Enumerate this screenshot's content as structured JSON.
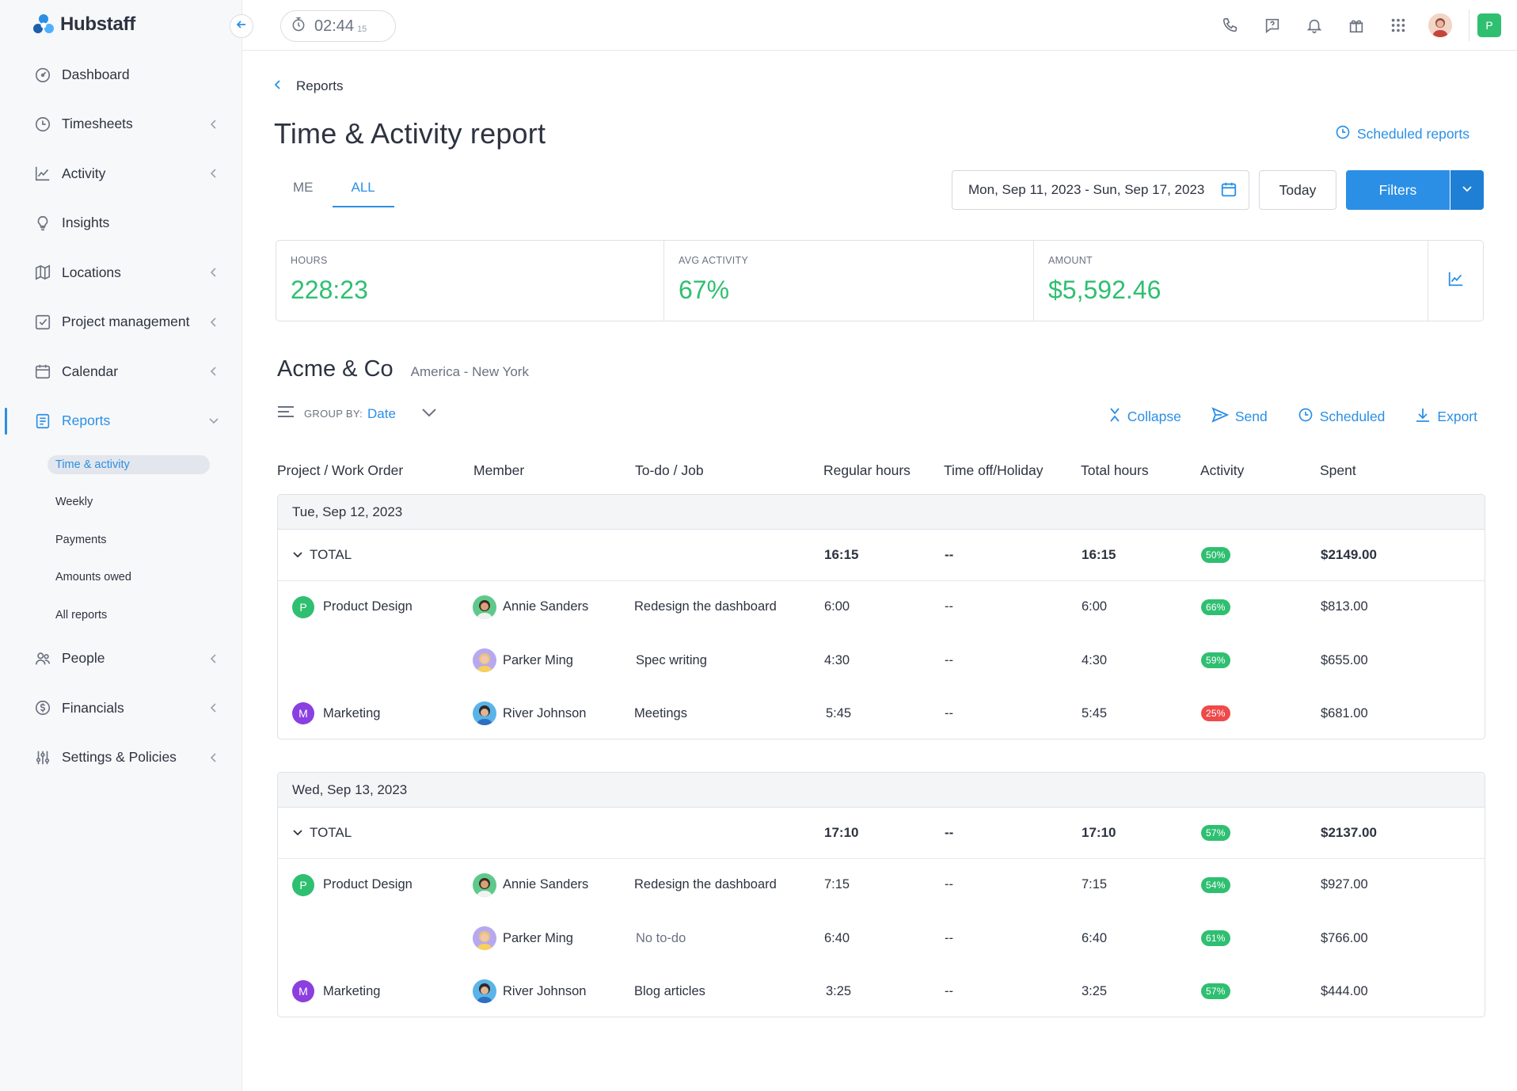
{
  "app": {
    "name": "Hubstaff"
  },
  "sidebar": {
    "items": [
      {
        "label": "Dashboard",
        "icon": "dashboard-icon",
        "chevron": false
      },
      {
        "label": "Timesheets",
        "icon": "clock-icon",
        "chevron": true
      },
      {
        "label": "Activity",
        "icon": "chart-line-icon",
        "chevron": true
      },
      {
        "label": "Insights",
        "icon": "lightbulb-icon",
        "chevron": false
      },
      {
        "label": "Locations",
        "icon": "map-icon",
        "chevron": true
      },
      {
        "label": "Project management",
        "icon": "checkbox-icon",
        "chevron": true
      },
      {
        "label": "Calendar",
        "icon": "calendar-icon",
        "chevron": true
      },
      {
        "label": "Reports",
        "icon": "report-icon",
        "chevron": true,
        "active": true
      },
      {
        "label": "People",
        "icon": "people-icon",
        "chevron": true
      },
      {
        "label": "Financials",
        "icon": "dollar-icon",
        "chevron": true
      },
      {
        "label": "Settings & Policies",
        "icon": "sliders-icon",
        "chevron": true
      }
    ],
    "reports_sub": [
      "Time & activity",
      "Weekly",
      "Payments",
      "Amounts owed",
      "All reports"
    ]
  },
  "topbar": {
    "timer": "02:44",
    "timer_seconds": "15",
    "user_initial": "P"
  },
  "breadcrumb": "Reports",
  "page_title": "Time & Activity report",
  "scheduled_reports": "Scheduled reports",
  "tabs": [
    "ME",
    "ALL"
  ],
  "date_range": "Mon, Sep 11, 2023 - Sun, Sep 17, 2023",
  "today_label": "Today",
  "filters_label": "Filters",
  "summary": [
    {
      "label": "HOURS",
      "value": "228:23"
    },
    {
      "label": "AVG ACTIVITY",
      "value": "67%"
    },
    {
      "label": "AMOUNT",
      "value": "$5,592.46"
    }
  ],
  "org": {
    "name": "Acme & Co",
    "timezone": "America - New York"
  },
  "group_by": {
    "label": "GROUP BY:",
    "value": "Date"
  },
  "actions": [
    "Collapse",
    "Send",
    "Scheduled",
    "Export"
  ],
  "columns": [
    "Project / Work Order",
    "Member",
    "To-do / Job",
    "Regular hours",
    "Time off/Holiday",
    "Total hours",
    "Activity",
    "Spent"
  ],
  "groups": [
    {
      "date": "Tue, Sep 12, 2023",
      "total": {
        "label": "TOTAL",
        "regular": "16:15",
        "timeoff": "--",
        "total": "16:15",
        "activity": "50%",
        "spent": "$2149.00"
      },
      "rows": [
        {
          "project": "Product Design",
          "project_initial": "P",
          "project_color": "#2fbf71",
          "member": "Annie Sanders",
          "todo": "Redesign the dashboard",
          "regular": "6:00",
          "timeoff": "--",
          "total": "6:00",
          "activity": "66%",
          "activity_color": "#2fbf71",
          "spent": "$813.00"
        },
        {
          "project": "",
          "member": "Parker Ming",
          "todo": "Spec writing",
          "regular": "4:30",
          "timeoff": "--",
          "total": "4:30",
          "activity": "59%",
          "activity_color": "#2fbf71",
          "spent": "$655.00"
        },
        {
          "project": "Marketing",
          "project_initial": "M",
          "project_color": "#8b3fe0",
          "member": "River Johnson",
          "todo": "Meetings",
          "regular": "5:45",
          "timeoff": "--",
          "total": "5:45",
          "activity": "25%",
          "activity_color": "#ef4a4a",
          "spent": "$681.00"
        }
      ]
    },
    {
      "date": "Wed, Sep 13, 2023",
      "total": {
        "label": "TOTAL",
        "regular": "17:10",
        "timeoff": "--",
        "total": "17:10",
        "activity": "57%",
        "spent": "$2137.00"
      },
      "rows": [
        {
          "project": "Product Design",
          "project_initial": "P",
          "project_color": "#2fbf71",
          "member": "Annie Sanders",
          "todo": "Redesign the dashboard",
          "regular": "7:15",
          "timeoff": "--",
          "total": "7:15",
          "activity": "54%",
          "activity_color": "#2fbf71",
          "spent": "$927.00"
        },
        {
          "project": "",
          "member": "Parker Ming",
          "todo": "No to-do",
          "todo_muted": true,
          "regular": "6:40",
          "timeoff": "--",
          "total": "6:40",
          "activity": "61%",
          "activity_color": "#2fbf71",
          "spent": "$766.00"
        },
        {
          "project": "Marketing",
          "project_initial": "M",
          "project_color": "#8b3fe0",
          "member": "River Johnson",
          "todo": "Blog articles",
          "regular": "3:25",
          "timeoff": "--",
          "total": "3:25",
          "activity": "57%",
          "activity_color": "#2fbf71",
          "spent": "$444.00"
        }
      ]
    }
  ]
}
